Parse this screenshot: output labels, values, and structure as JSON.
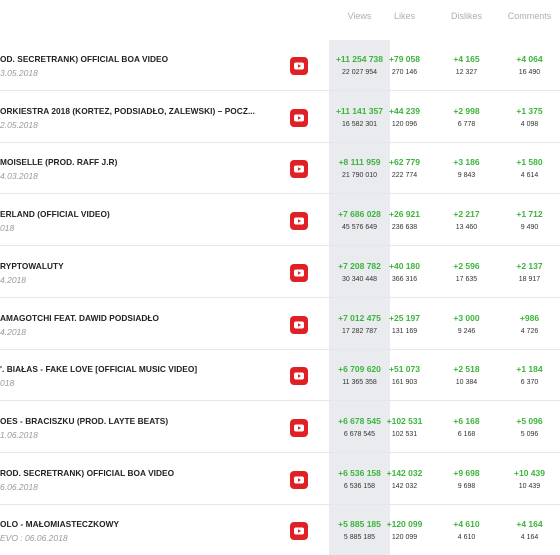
{
  "headers": {
    "views": "Views",
    "likes": "Likes",
    "dislikes": "Dislikes",
    "comments": "Comments"
  },
  "colors": {
    "delta_green": "#3cb43c",
    "youtube_red": "#e12026",
    "views_column_bg": "#e9ebee"
  },
  "rows": [
    {
      "title": "OD. SECRETRANK) OFFICIAL BOA VIDEO",
      "date": "3.05.2018",
      "views_delta": "+11 254 738",
      "views_total": "22 027 954",
      "likes_delta": "+79 058",
      "likes_total": "270 146",
      "dislikes_delta": "+4 165",
      "dislikes_total": "12 327",
      "comments_delta": "+4 064",
      "comments_total": "16 490"
    },
    {
      "title": "ORKIESTRA 2018 (KORTEZ, PODSIADŁO, ZALEWSKI) – POCZ...",
      "date": "2.05.2018",
      "views_delta": "+11 141 357",
      "views_total": "16 582 301",
      "likes_delta": "+44 239",
      "likes_total": "120 096",
      "dislikes_delta": "+2 998",
      "dislikes_total": "6 778",
      "comments_delta": "+1 375",
      "comments_total": "4 098"
    },
    {
      "title": "MOISELLE (PROD. RAFF J.R)",
      "date": "4.03.2018",
      "views_delta": "+8 111 959",
      "views_total": "21 790 010",
      "likes_delta": "+62 779",
      "likes_total": "222 774",
      "dislikes_delta": "+3 186",
      "dislikes_total": "9 843",
      "comments_delta": "+1 580",
      "comments_total": "4 614"
    },
    {
      "title": "ERLAND (OFFICIAL VIDEO)",
      "date": "018",
      "views_delta": "+7 686 028",
      "views_total": "45 576 649",
      "likes_delta": "+26 921",
      "likes_total": "236 638",
      "dislikes_delta": "+2 217",
      "dislikes_total": "13 460",
      "comments_delta": "+1 712",
      "comments_total": "9 490"
    },
    {
      "title": "RYPTOWALUTY",
      "date": "4.2018",
      "views_delta": "+7 208 782",
      "views_total": "30 340 448",
      "likes_delta": "+40 180",
      "likes_total": "366 316",
      "dislikes_delta": "+2 596",
      "dislikes_total": "17 635",
      "comments_delta": "+2 137",
      "comments_total": "18 917"
    },
    {
      "title": "AMAGOTCHI FEAT. DAWID PODSIADŁO",
      "date": "4.2018",
      "views_delta": "+7 012 475",
      "views_total": "17 282 787",
      "likes_delta": "+25 197",
      "likes_total": "131 169",
      "dislikes_delta": "+3 000",
      "dislikes_total": "9 246",
      "comments_delta": "+986",
      "comments_total": "4 726"
    },
    {
      "title": "'. BIAŁAS - FAKE LOVE [OFFICIAL MUSIC VIDEO]",
      "date": "018",
      "views_delta": "+6 709 620",
      "views_total": "11 365 358",
      "likes_delta": "+51 073",
      "likes_total": "161 903",
      "dislikes_delta": "+2 518",
      "dislikes_total": "10 384",
      "comments_delta": "+1 184",
      "comments_total": "6 370"
    },
    {
      "title": "OES - BRACISZKU (PROD. LAYTE BEATS)",
      "date": "1.06.2018",
      "views_delta": "+6 678 545",
      "views_total": "6 678 545",
      "likes_delta": "+102 531",
      "likes_total": "102 531",
      "dislikes_delta": "+6 168",
      "dislikes_total": "6 168",
      "comments_delta": "+5 096",
      "comments_total": "5 096"
    },
    {
      "title": "ROD. SECRETRANK) OFFICIAL BOA VIDEO",
      "date": "6.06.2018",
      "views_delta": "+6 536 158",
      "views_total": "6 536 158",
      "likes_delta": "+142 032",
      "likes_total": "142 032",
      "dislikes_delta": "+9 698",
      "dislikes_total": "9 698",
      "comments_delta": "+10 439",
      "comments_total": "10 439"
    },
    {
      "title": "OLO - MAŁOMIASTECZKOWY",
      "date": "EVO : 06.06.2018",
      "views_delta": "+5 885 185",
      "views_total": "5 885 185",
      "likes_delta": "+120 099",
      "likes_total": "120 099",
      "dislikes_delta": "+4 610",
      "dislikes_total": "4 610",
      "comments_delta": "+4 164",
      "comments_total": "4 164"
    }
  ]
}
